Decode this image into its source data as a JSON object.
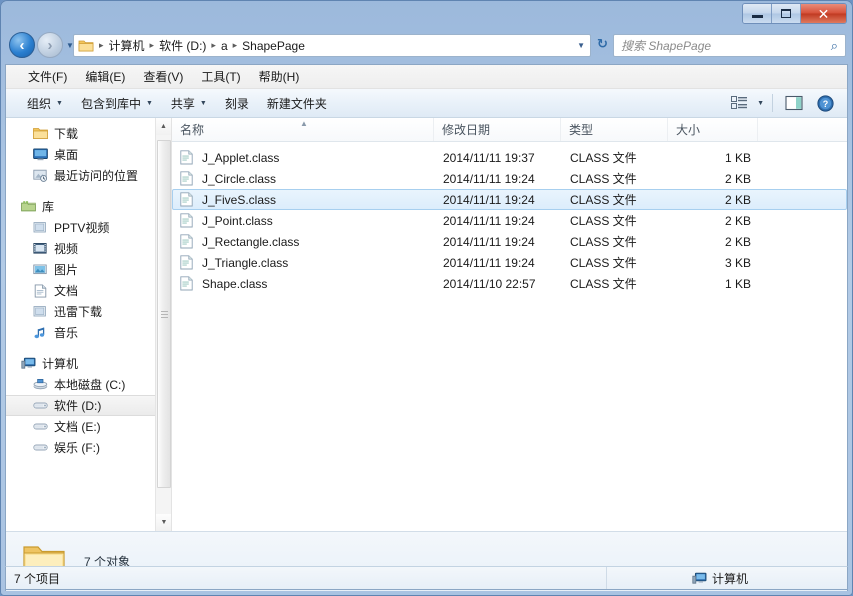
{
  "window": {
    "minimize_label": "最小化",
    "maximize_label": "最大化",
    "close_label": "关闭"
  },
  "navigation": {
    "back_label": "后退",
    "forward_label": "前进",
    "recent_dropdown_label": "最近浏览的位置",
    "refresh_label": "刷新",
    "address_dropdown_label": "以前的位置"
  },
  "breadcrumb": {
    "separator": "▸",
    "items": [
      "计算机",
      "软件 (D:)",
      "a",
      "ShapePage"
    ]
  },
  "search": {
    "placeholder": "搜索 ShapePage",
    "value": ""
  },
  "menubar": {
    "items": [
      "文件(F)",
      "编辑(E)",
      "查看(V)",
      "工具(T)",
      "帮助(H)"
    ]
  },
  "commandbar": {
    "buttons": [
      {
        "label": "组织",
        "has_caret": true
      },
      {
        "label": "包含到库中",
        "has_caret": true
      },
      {
        "label": "共享",
        "has_caret": true
      },
      {
        "label": "刻录",
        "has_caret": false
      },
      {
        "label": "新建文件夹",
        "has_caret": false
      }
    ],
    "view_label": "更改您的视图",
    "preview_label": "显示预览窗格",
    "help_label": "获取帮助"
  },
  "sidebar": {
    "groups": [
      {
        "name": "favorites",
        "items": [
          {
            "label": "下载",
            "icon": "folder-icon",
            "indent": 1,
            "selected": false
          },
          {
            "label": "桌面",
            "icon": "desktop-icon",
            "indent": 1,
            "selected": false
          },
          {
            "label": "最近访问的位置",
            "icon": "recent-places-icon",
            "indent": 1,
            "selected": false
          }
        ]
      },
      {
        "name": "libraries",
        "items": [
          {
            "label": "库",
            "icon": "library-icon",
            "indent": 0,
            "selected": false
          },
          {
            "label": "PPTV视频",
            "icon": "library-folder-icon",
            "indent": 1,
            "selected": false
          },
          {
            "label": "视频",
            "icon": "video-library-icon",
            "indent": 1,
            "selected": false
          },
          {
            "label": "图片",
            "icon": "pictures-library-icon",
            "indent": 1,
            "selected": false
          },
          {
            "label": "文档",
            "icon": "documents-library-icon",
            "indent": 1,
            "selected": false
          },
          {
            "label": "迅雷下载",
            "icon": "library-folder-icon",
            "indent": 1,
            "selected": false
          },
          {
            "label": "音乐",
            "icon": "music-library-icon",
            "indent": 1,
            "selected": false
          }
        ]
      },
      {
        "name": "computer",
        "items": [
          {
            "label": "计算机",
            "icon": "computer-icon",
            "indent": 0,
            "selected": false
          },
          {
            "label": "本地磁盘 (C:)",
            "icon": "system-drive-icon",
            "indent": 1,
            "selected": false
          },
          {
            "label": "软件 (D:)",
            "icon": "drive-icon",
            "indent": 1,
            "selected": true
          },
          {
            "label": "文档 (E:)",
            "icon": "drive-icon",
            "indent": 1,
            "selected": false
          },
          {
            "label": "娱乐 (F:)",
            "icon": "drive-icon",
            "indent": 1,
            "selected": false
          }
        ]
      }
    ],
    "scroll_up_label": "向上滚动",
    "scroll_down_label": "向下滚动"
  },
  "filelist": {
    "columns": [
      {
        "key": "name",
        "label": "名称",
        "sorted": true,
        "sort_direction": "asc"
      },
      {
        "key": "date",
        "label": "修改日期",
        "sorted": false
      },
      {
        "key": "type",
        "label": "类型",
        "sorted": false
      },
      {
        "key": "size",
        "label": "大小",
        "sorted": false
      }
    ],
    "sort_arrow": "▲",
    "rows": [
      {
        "name": "J_Applet.class",
        "date": "2014/11/11 19:37",
        "type": "CLASS 文件",
        "size": "1 KB",
        "selected": false
      },
      {
        "name": "J_Circle.class",
        "date": "2014/11/11 19:24",
        "type": "CLASS 文件",
        "size": "2 KB",
        "selected": false
      },
      {
        "name": "J_FiveS.class",
        "date": "2014/11/11 19:24",
        "type": "CLASS 文件",
        "size": "2 KB",
        "selected": true
      },
      {
        "name": "J_Point.class",
        "date": "2014/11/11 19:24",
        "type": "CLASS 文件",
        "size": "2 KB",
        "selected": false
      },
      {
        "name": "J_Rectangle.class",
        "date": "2014/11/11 19:24",
        "type": "CLASS 文件",
        "size": "2 KB",
        "selected": false
      },
      {
        "name": "J_Triangle.class",
        "date": "2014/11/11 19:24",
        "type": "CLASS 文件",
        "size": "3 KB",
        "selected": false
      },
      {
        "name": "Shape.class",
        "date": "2014/11/10 22:57",
        "type": "CLASS 文件",
        "size": "1 KB",
        "selected": false
      }
    ]
  },
  "details_pane": {
    "title": "7 个对象"
  },
  "statusbar": {
    "item_count": "7 个项目",
    "location": "计算机"
  },
  "colors": {
    "title_bar": "#a9c3e2",
    "close_button": "#c03a22",
    "selection": "#dcedfc",
    "selection_border": "#a7cfef",
    "folder_yellow": "#f5cf73",
    "accent_blue": "#2a7fd0"
  }
}
